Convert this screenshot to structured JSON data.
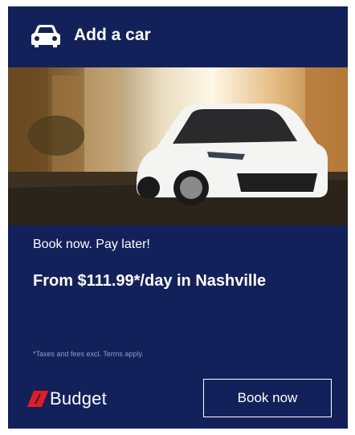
{
  "header": {
    "title": "Add a car",
    "icon": "car-icon"
  },
  "hero": {
    "image": "white sedan on city street at sunset"
  },
  "offer": {
    "tagline": "Book now. Pay later!",
    "price_line": "From $111.99*/day in Nashville",
    "disclaimer": "*Taxes and fees excl. Terms apply."
  },
  "brand": {
    "name": "Budget",
    "accent_color": "#e31b23"
  },
  "cta": {
    "label": "Book now"
  },
  "colors": {
    "background": "#13215a",
    "text": "#ffffff"
  }
}
